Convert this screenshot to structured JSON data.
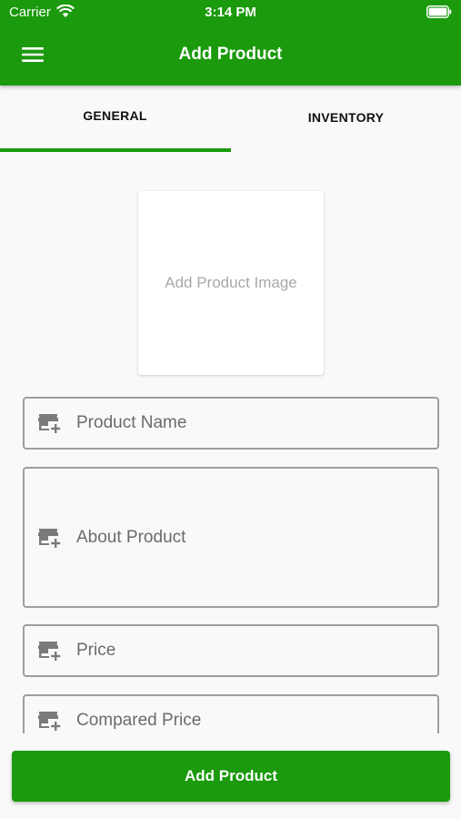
{
  "status_bar": {
    "carrier": "Carrier",
    "time": "3:14 PM"
  },
  "header": {
    "title": "Add Product",
    "background": "#1a9a0c"
  },
  "tabs": [
    {
      "label": "GENERAL",
      "active": true
    },
    {
      "label": "INVENTORY",
      "active": false
    }
  ],
  "image_picker": {
    "label": "Add Product Image"
  },
  "form": {
    "fields": [
      {
        "placeholder": "Product Name",
        "icon": "store-add-icon"
      },
      {
        "placeholder": "About Product",
        "icon": "store-add-icon"
      },
      {
        "placeholder": "Price",
        "icon": "store-add-icon"
      },
      {
        "placeholder": "Compared Price",
        "icon": "store-add-icon"
      }
    ]
  },
  "submit_button": {
    "label": "Add Product"
  }
}
